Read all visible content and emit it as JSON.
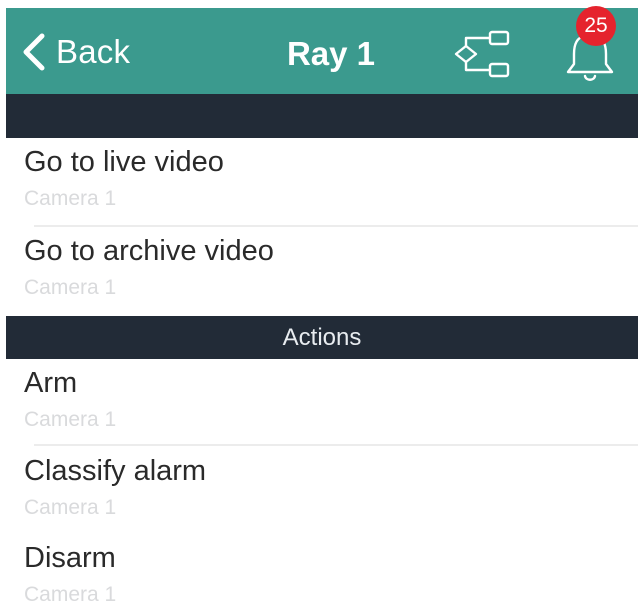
{
  "header": {
    "back_label": "Back",
    "title": "Ray 1",
    "notification_count": "25",
    "accent_color": "#3b9a8e",
    "badge_color": "#e5232d",
    "icons": [
      "chevron-left-icon",
      "tree-structure-icon",
      "bell-icon"
    ]
  },
  "sections": [
    {
      "header_label": "",
      "items": [
        {
          "title": "Go to live video",
          "subtitle": "Camera 1"
        },
        {
          "title": "Go to archive video",
          "subtitle": "Camera 1"
        }
      ]
    },
    {
      "header_label": "Actions",
      "items": [
        {
          "title": "Arm",
          "subtitle": "Camera 1"
        },
        {
          "title": "Classify alarm",
          "subtitle": "Camera 1"
        },
        {
          "title": "Disarm",
          "subtitle": "Camera 1"
        }
      ]
    }
  ]
}
